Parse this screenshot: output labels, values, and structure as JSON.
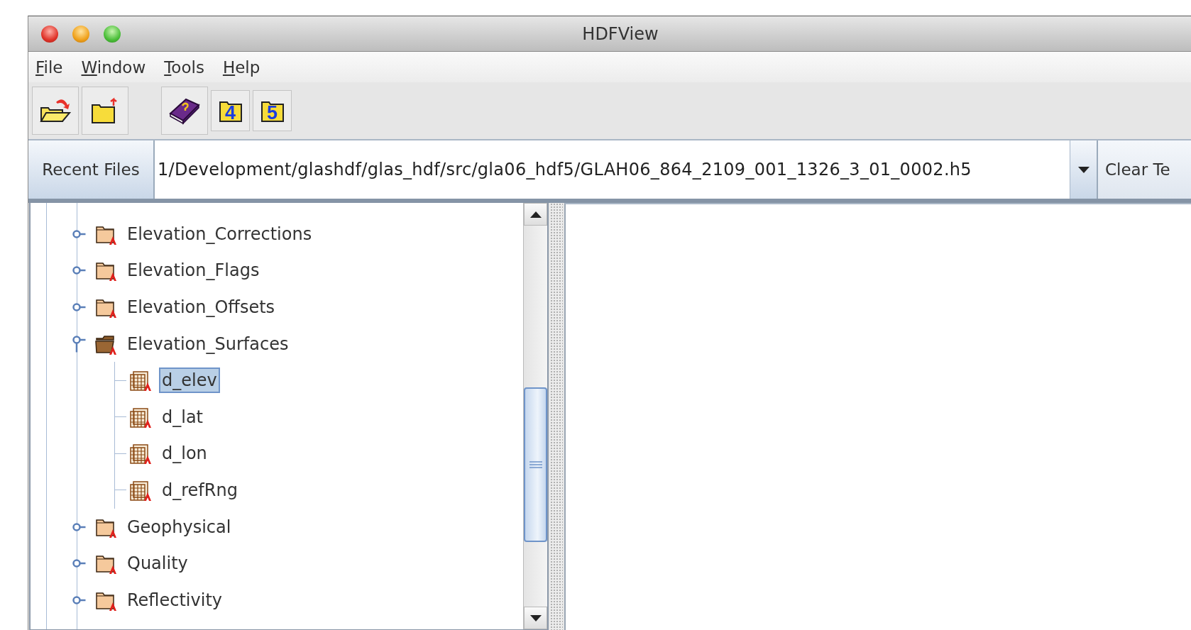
{
  "window": {
    "title": "HDFView"
  },
  "menu": [
    "File",
    "Window",
    "Tools",
    "Help"
  ],
  "toolbar": [
    [
      {
        "kind": "open"
      },
      {
        "kind": "close"
      }
    ],
    [
      {
        "kind": "help"
      },
      {
        "kind": "version",
        "label": "4"
      },
      {
        "kind": "version",
        "label": "5"
      }
    ]
  ],
  "recent_files": {
    "button": "Recent Files",
    "path": "1/Development/glashdf/glas_hdf/src/gla06_hdf5/GLAH06_864_2109_001_1326_3_01_0002.h5",
    "clear_button": "Clear Te"
  },
  "tree": [
    {
      "label": "Elevation_Corrections",
      "kind": "group",
      "expanded": false,
      "selected": false
    },
    {
      "label": "Elevation_Flags",
      "kind": "group",
      "expanded": false,
      "selected": false
    },
    {
      "label": "Elevation_Offsets",
      "kind": "group",
      "expanded": false,
      "selected": false
    },
    {
      "label": "Elevation_Surfaces",
      "kind": "group",
      "expanded": true,
      "selected": false,
      "children": [
        {
          "label": "d_elev",
          "kind": "dataset",
          "selected": true
        },
        {
          "label": "d_lat",
          "kind": "dataset",
          "selected": false
        },
        {
          "label": "d_lon",
          "kind": "dataset",
          "selected": false
        },
        {
          "label": "d_refRng",
          "kind": "dataset",
          "selected": false
        }
      ]
    },
    {
      "label": "Geophysical",
      "kind": "group",
      "expanded": false,
      "selected": false
    },
    {
      "label": "Quality",
      "kind": "group",
      "expanded": false,
      "selected": false
    },
    {
      "label": "Reflectivity",
      "kind": "group",
      "expanded": false,
      "selected": false
    }
  ]
}
